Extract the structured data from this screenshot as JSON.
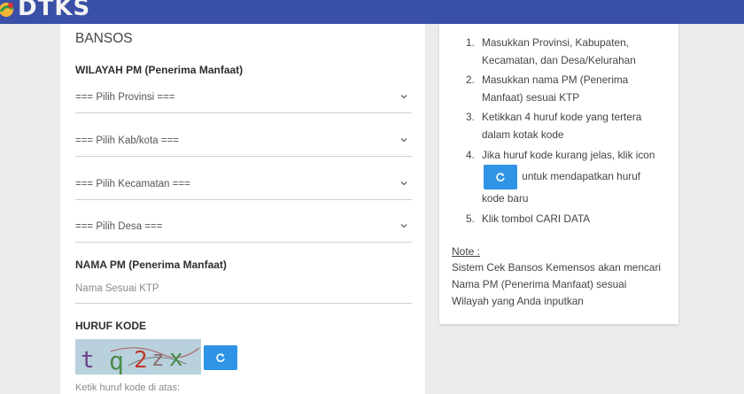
{
  "header": {
    "logo_text": "DTKS"
  },
  "form": {
    "heading": "BANSOS",
    "wilayah_label": "WILAYAH PM (Penerima Manfaat)",
    "selects": [
      "=== Pilih Provinsi ===",
      "=== Pilih Kab/kota ===",
      "=== Pilih Kecamatan ===",
      "=== Pilih Desa ==="
    ],
    "nama_label": "NAMA PM (Penerima Manfaat)",
    "nama_placeholder": "Nama Sesuai KTP",
    "kode_label": "HURUF KODE",
    "captcha_text": "t q2x",
    "captcha_hint": "Ketik huruf kode di atas:"
  },
  "info": {
    "steps": [
      {
        "num": "1.",
        "text": "Masukkan Provinsi, Kabupaten, Kecamatan, dan Desa/Kelurahan"
      },
      {
        "num": "2.",
        "text": "Masukkan nama PM (Penerima Manfaat) sesuai KTP"
      },
      {
        "num": "3.",
        "text": "Ketikkan 4 huruf kode yang tertera dalam kotak kode"
      },
      {
        "num": "4.",
        "text_before": "Jika huruf kode kurang jelas, klik icon",
        "text_after": "untuk mendapatkan huruf kode baru"
      },
      {
        "num": "5.",
        "text": "Klik tombol CARI DATA"
      }
    ],
    "note_title": "Note :",
    "note_body": "Sistem Cek Bansos Kemensos akan mencari Nama PM (Penerima Manfaat) sesuai Wilayah yang Anda inputkan"
  },
  "colors": {
    "header": "#3a4fa6",
    "accent_button": "#2f93e6",
    "background": "#ececec"
  },
  "icons": [
    "logo-icon",
    "chevron-down-icon",
    "refresh-icon"
  ]
}
